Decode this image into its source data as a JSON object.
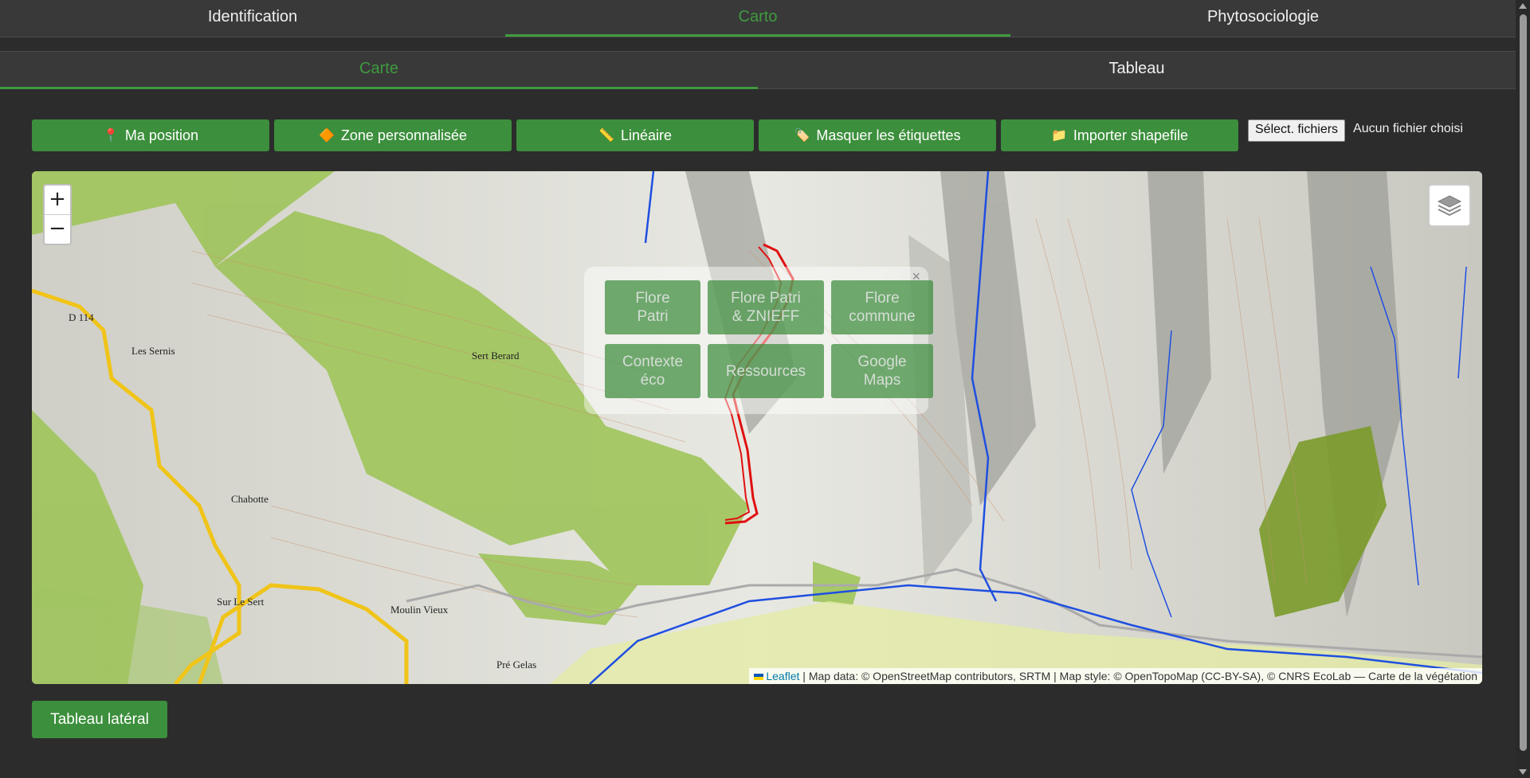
{
  "tabs_main": [
    {
      "label": "Identification",
      "active": false
    },
    {
      "label": "Carto",
      "active": true
    },
    {
      "label": "Phytosociologie",
      "active": false
    }
  ],
  "tabs_sub": [
    {
      "label": "Carte",
      "active": true
    },
    {
      "label": "Tableau",
      "active": false
    }
  ],
  "toolbar": {
    "buttons": [
      {
        "label": "Ma position",
        "icon": "map-pin-icon"
      },
      {
        "label": "Zone personnalisée",
        "icon": "orange-diamond-icon"
      },
      {
        "label": "Linéaire",
        "icon": "ruler-icon"
      },
      {
        "label": "Masquer les étiquettes",
        "icon": "tag-icon"
      },
      {
        "label": "Importer shapefile",
        "icon": "folder-icon"
      }
    ],
    "file_button": "Sélect. fichiers",
    "file_status": "Aucun fichier choisi"
  },
  "map": {
    "zoom_in": "+",
    "zoom_out": "−",
    "place_labels": [
      "D 114",
      "Les Sernis",
      "Sert Berard",
      "Chabotte",
      "Sur Le Sert",
      "Moulin Vieux",
      "Pré Gelas"
    ],
    "overlay_buttons": [
      "Flore\nPatri",
      "Flore Patri\n& ZNIEFF",
      "Flore\ncommune",
      "Contexte\néco",
      "Ressources",
      "Google\nMaps"
    ],
    "attribution_link": "Leaflet",
    "attribution_text": " | Map data: © OpenStreetMap contributors, SRTM | Map style: © OpenTopoMap (CC-BY-SA), © CNRS EcoLab — Carte de la végétation",
    "colors": {
      "forest": "#9fc45a",
      "route": "#e01010",
      "river": "#1f4fe0",
      "road": "#f0c419"
    }
  },
  "side_button": "Tableau latéral"
}
